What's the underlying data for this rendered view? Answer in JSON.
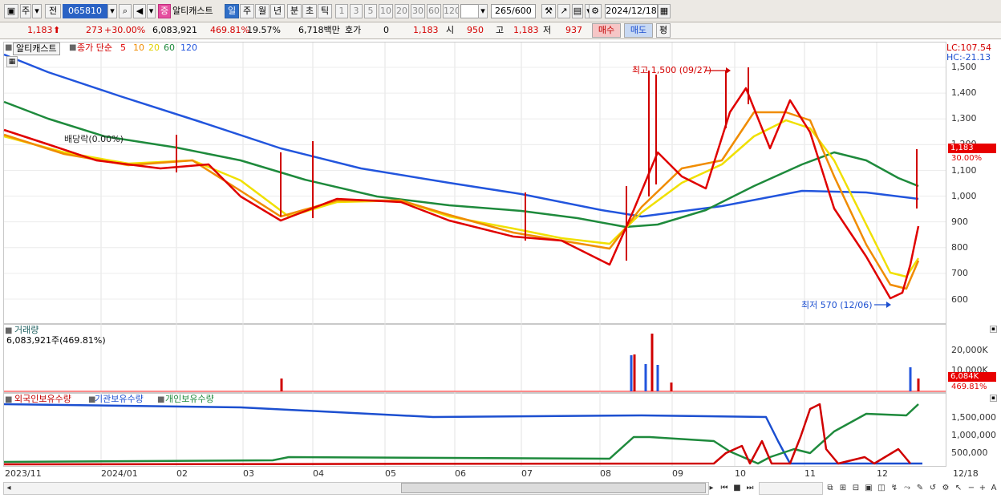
{
  "toolbar": {
    "market": "주",
    "prev_label": "전",
    "code": "065810",
    "indicator_badge": "증",
    "stock_name": "알티캐스트",
    "periods": [
      "일",
      "주",
      "월",
      "년",
      "분",
      "초",
      "틱"
    ],
    "selected_period": "일",
    "intervals": [
      "1",
      "3",
      "5",
      "10",
      "20",
      "30",
      "60",
      "120"
    ],
    "count": "265",
    "count_max": "/600",
    "date": "2024/12/18"
  },
  "quote": {
    "price": "1,183",
    "change": "273",
    "change_pct": "+30.00%",
    "volume": "6,083,921",
    "volume_pct": "469.81%",
    "turnover": "19.57%",
    "amount": "6,718백만",
    "hoga_label": "호가",
    "hoga_value": "0",
    "hoga_price": "1,183",
    "open_label": "시",
    "open": "950",
    "high_label": "고",
    "high": "1,183",
    "low_label": "저",
    "low": "937",
    "buy_label": "매수",
    "sell_label": "매도",
    "eval_label": "평"
  },
  "price_panel": {
    "stock_label": "알티캐스트",
    "ma_label": "종가 단순",
    "ma_periods": [
      "5",
      "10",
      "20",
      "60",
      "120"
    ],
    "ma_colors": [
      "#e00000",
      "#f08c00",
      "#f0e000",
      "#1e8a3c",
      "#2255dd"
    ],
    "dividend_label": "배당락(0.00%)",
    "high_annotation": "최고 1,500 (09/27)",
    "low_annotation": "최저 570 (12/06)",
    "lc": "LC:107.54",
    "hc": "HC:-21.13",
    "y_ticks": [
      "1,500",
      "1,400",
      "1,300",
      "1,200",
      "1,100",
      "1,000",
      "900",
      "800",
      "700",
      "600"
    ],
    "price_tag": "1,183",
    "pct_tag": "30.00%"
  },
  "volume_panel": {
    "title": "거래량",
    "value": "6,083,921주(469.81%)",
    "y_ticks": [
      "20,000K",
      "10,000K"
    ],
    "vol_tag": "6,084K",
    "pct_tag": "469.81%"
  },
  "holding_panel": {
    "legend": [
      "외국인보유수량",
      "기관보유수량",
      "개인보유수량"
    ],
    "legend_colors": [
      "#c00000",
      "#1c4fd0",
      "#1e8a3c"
    ],
    "y_ticks": [
      "1,500,000",
      "1,000,000",
      "500,000"
    ]
  },
  "x_axis": [
    "2023/11",
    "2024/01",
    "02",
    "03",
    "04",
    "05",
    "06",
    "07",
    "08",
    "09",
    "10",
    "11",
    "12",
    "12/18"
  ]
}
